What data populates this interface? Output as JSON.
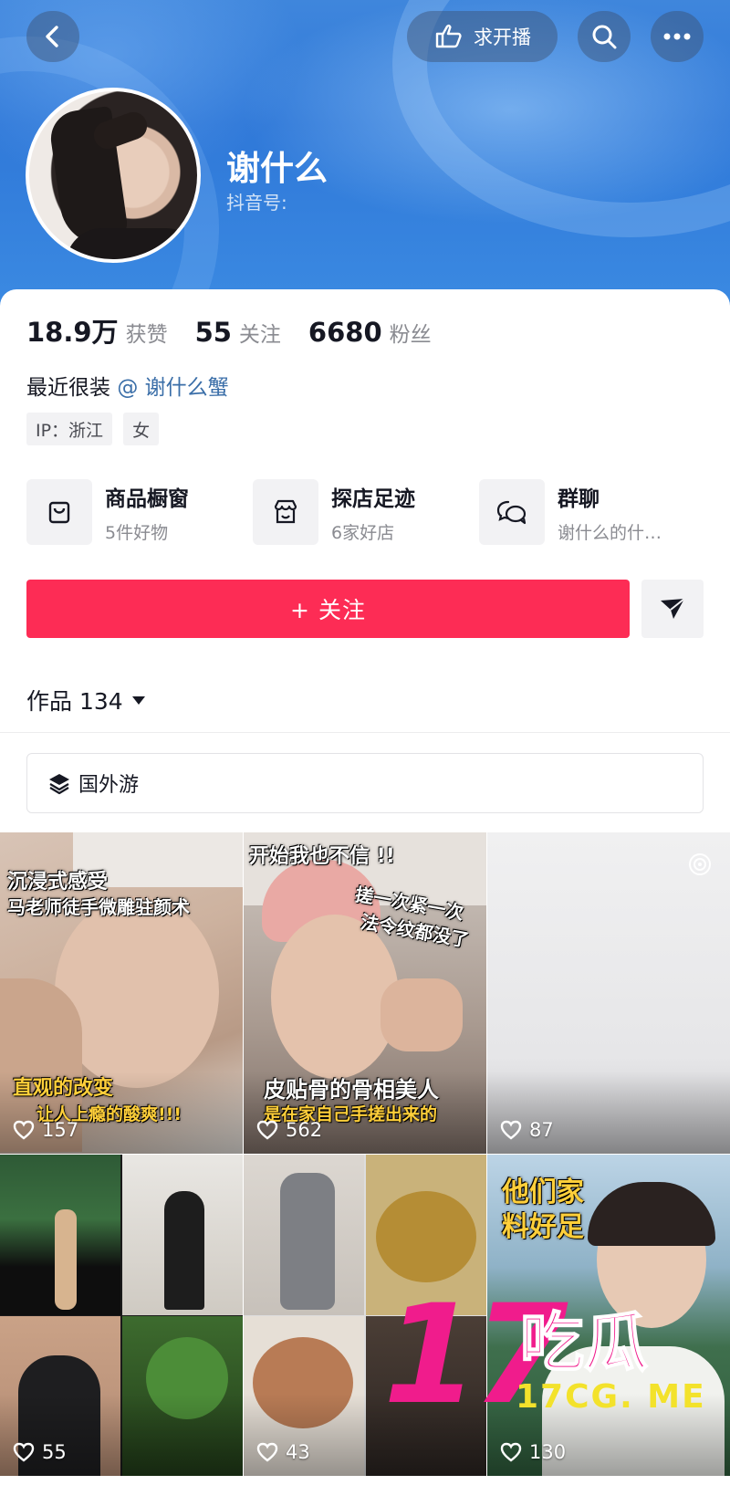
{
  "header": {
    "back_icon": "chevron-left-icon",
    "live_request_label": "求开播",
    "search_icon": "search-icon",
    "more_icon": "more-icon"
  },
  "profile": {
    "nickname": "谢什么",
    "douyin_id_label": "抖音号:",
    "stats": [
      {
        "value": "18.9万",
        "label": "获赞"
      },
      {
        "value": "55",
        "label": "关注"
      },
      {
        "value": "6680",
        "label": "粉丝"
      }
    ],
    "bio_text": "最近很装",
    "bio_mention": "@ 谢什么蟹",
    "tags": [
      "IP：浙江",
      "女"
    ]
  },
  "services": [
    {
      "title": "商品橱窗",
      "subtitle": "5件好物",
      "icon": "shop-bag-icon"
    },
    {
      "title": "探店足迹",
      "subtitle": "6家好店",
      "icon": "store-icon"
    },
    {
      "title": "群聊",
      "subtitle": "谢什么的什…",
      "icon": "chat-icon"
    }
  ],
  "actions": {
    "follow_label": "+ 关注",
    "message_icon": "send-icon"
  },
  "works": {
    "tab_label": "作品 134",
    "collection_label": "国外游"
  },
  "videos": [
    {
      "likes": "157",
      "caption_top": "沉浸式感受",
      "caption_top2": "马老师徒手微雕驻颜术",
      "caption_bottom": "直观的改变",
      "caption_bottom2": "让人上瘾的酸爽!!!"
    },
    {
      "likes": "562",
      "caption_top": "开始我也不信 !!",
      "caption_mid": "搓一次紧一次",
      "caption_mid2": "法令纹都没了",
      "caption_bottom": "皮贴骨的骨相美人",
      "caption_bottom2": "是在家自己手搓出来的"
    },
    {
      "likes": "87"
    },
    {
      "likes": "55"
    },
    {
      "likes": "43"
    },
    {
      "likes": "130",
      "caption_top": "他们家",
      "caption_top2": "料好足"
    }
  ],
  "watermark": {
    "number": "17",
    "chinese": "吃瓜",
    "url": "17CG. ME"
  },
  "colors": {
    "accent_red": "#fd2c55",
    "header_blue": "#3f86dc",
    "mention_blue": "#3a6ea8",
    "watermark_pink": "#f01c8c",
    "watermark_yellow": "#f3e22b"
  }
}
